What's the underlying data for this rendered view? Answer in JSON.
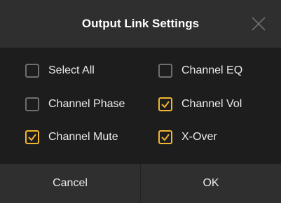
{
  "dialog": {
    "title": "Output Link Settings",
    "close_icon": "close-x-icon"
  },
  "options": [
    {
      "label": "Select All",
      "checked": false
    },
    {
      "label": "Channel EQ",
      "checked": false
    },
    {
      "label": "Channel Phase",
      "checked": false
    },
    {
      "label": "Channel Vol",
      "checked": true
    },
    {
      "label": "Channel Mute",
      "checked": true
    },
    {
      "label": "X-Over",
      "checked": true
    }
  ],
  "footer": {
    "cancel_label": "Cancel",
    "ok_label": "OK"
  },
  "colors": {
    "accent": "#f2b632",
    "header_bg": "#2f2f2f",
    "body_bg": "#1d1d1d",
    "text": "#eaeaea"
  }
}
